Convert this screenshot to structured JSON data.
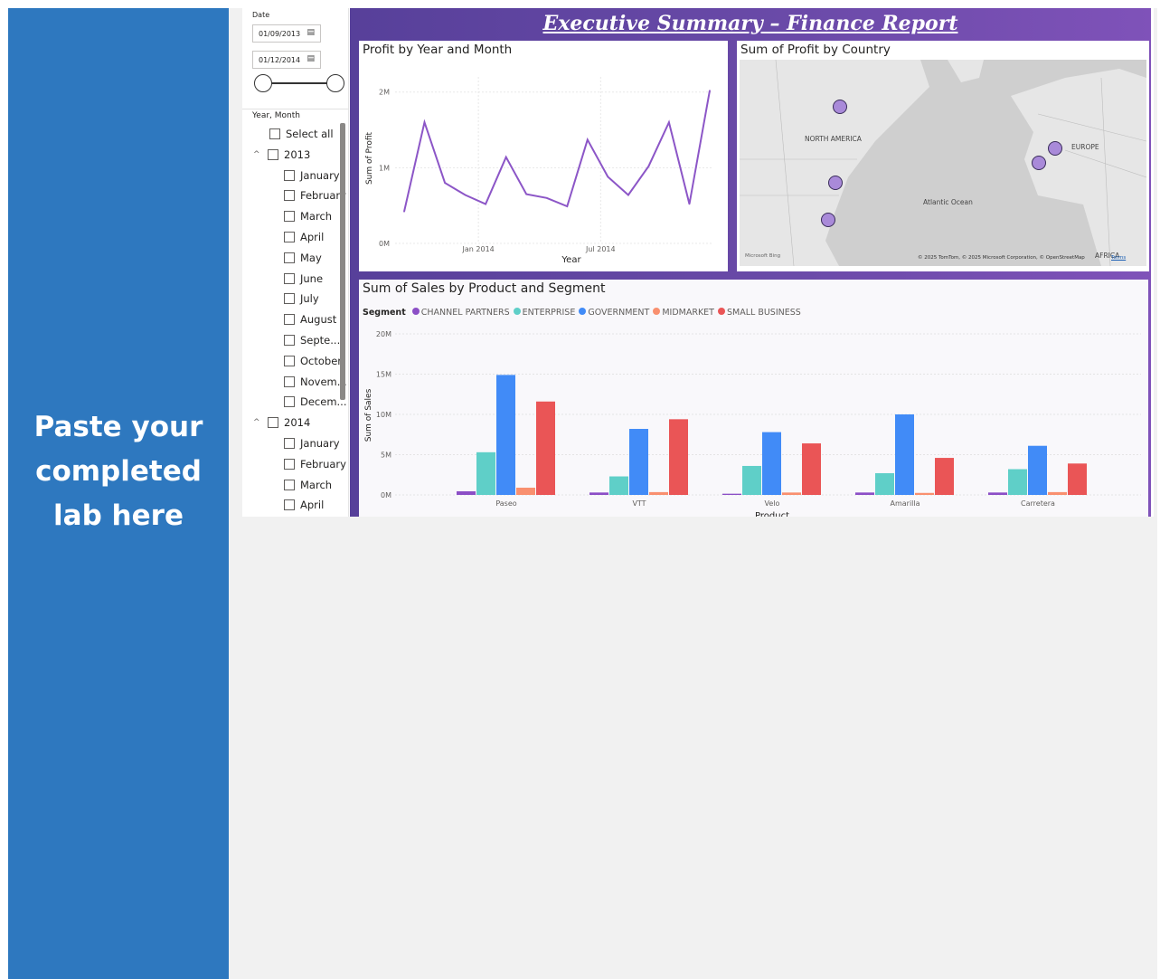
{
  "left_panel": {
    "instruction": "Paste your completed lab here"
  },
  "slicer": {
    "date_label": "Date",
    "start_date": "01/09/2013",
    "end_date": "01/12/2014",
    "hierarchy_title": "Year, Month",
    "select_all": "Select all",
    "years": [
      {
        "label": "2013",
        "months": [
          "January",
          "February",
          "March",
          "April",
          "May",
          "June",
          "July",
          "August",
          "Septe...",
          "October",
          "Novem...",
          "Decem..."
        ]
      },
      {
        "label": "2014",
        "months": [
          "January",
          "February",
          "March",
          "April"
        ]
      }
    ]
  },
  "dashboard": {
    "title": "Executive Summary – Finance Report",
    "map": {
      "title": "Sum of Profit by Country",
      "labels": {
        "north_america": "NORTH AMERICA",
        "europe": "EUROPE",
        "atlantic": "Atlantic Ocean",
        "africa": "AFRICA"
      },
      "attribution": "© 2025 TomTom, © 2025 Microsoft Corporation, © OpenStreetMap",
      "terms": "Terms",
      "bing": "Microsoft Bing"
    }
  },
  "chart_data": [
    {
      "type": "line",
      "title": "Profit by Year and Month",
      "xlabel": "Year",
      "ylabel": "Sum of Profit",
      "x_tick_labels": [
        "Jan 2014",
        "Jul 2014"
      ],
      "y_tick_labels": [
        "0M",
        "1M",
        "2M"
      ],
      "ylim": [
        0,
        2200000
      ],
      "series": [
        {
          "x": [
            "2013-09",
            "2013-10",
            "2013-11",
            "2013-12",
            "2014-01",
            "2014-02",
            "2014-03",
            "2014-04",
            "2014-05",
            "2014-06",
            "2014-07",
            "2014-08",
            "2014-09",
            "2014-10",
            "2014-11",
            "2014-12"
          ],
          "values": [
            420000,
            1600000,
            800000,
            640000,
            520000,
            1140000,
            650000,
            600000,
            490000,
            1370000,
            880000,
            640000,
            1020000,
            1600000,
            520000,
            2020000
          ],
          "color": "#8c56c7"
        }
      ],
      "grid": true
    },
    {
      "type": "bar",
      "title": "Sum of Sales by Product and Segment",
      "xlabel": "Product",
      "ylabel": "Sum of Sales",
      "legend_title": "Segment",
      "categories": [
        "Paseo",
        "VTT",
        "Velo",
        "Amarilla",
        "Carretera"
      ],
      "y_tick_labels": [
        "0M",
        "5M",
        "10M",
        "15M",
        "20M"
      ],
      "ylim": [
        0,
        20000000
      ],
      "series": [
        {
          "name": "CHANNEL PARTNERS",
          "color": "#8c4fc6",
          "values": [
            450000,
            300000,
            150000,
            300000,
            300000
          ]
        },
        {
          "name": "ENTERPRISE",
          "color": "#5fcfc8",
          "values": [
            5300000,
            2300000,
            3600000,
            2700000,
            3200000
          ]
        },
        {
          "name": "GOVERNMENT",
          "color": "#418bf7",
          "values": [
            14900000,
            8200000,
            7800000,
            10000000,
            6100000
          ]
        },
        {
          "name": "MIDMARKET",
          "color": "#f9906f",
          "values": [
            900000,
            350000,
            300000,
            250000,
            350000
          ]
        },
        {
          "name": "SMALL BUSINESS",
          "color": "#ea5556",
          "values": [
            11600000,
            9400000,
            6400000,
            4600000,
            3900000
          ]
        }
      ],
      "legend_position": "top-left",
      "grid": true
    }
  ]
}
